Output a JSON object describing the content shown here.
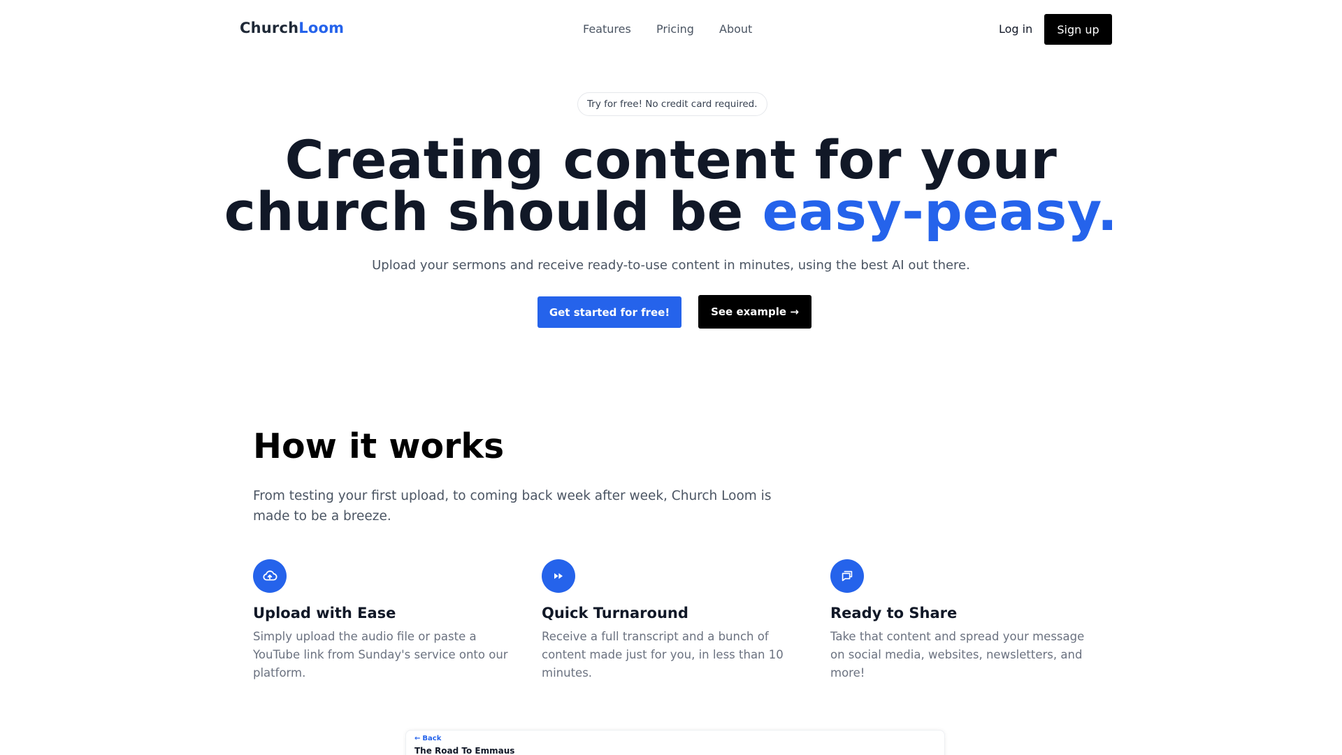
{
  "header": {
    "logo_part1": "Church",
    "logo_part2": "Loom",
    "nav": [
      "Features",
      "Pricing",
      "About"
    ],
    "login_label": "Log in",
    "signup_label": "Sign up"
  },
  "hero": {
    "pill": "Try for free! No credit card required.",
    "title_line1": "Creating content for your",
    "title_line2_plain": "church should be ",
    "title_line2_accent": "easy-peasy.",
    "subtitle": "Upload your sermons and receive ready-to-use content in minutes, using the best AI out there.",
    "primary_button": "Get started for free!",
    "secondary_button": "See example →"
  },
  "how": {
    "title": "How it works",
    "subtitle": "From testing your first upload, to coming back week after week, Church Loom is made to be a breeze.",
    "features": [
      {
        "icon": "cloud-upload-icon",
        "title": "Upload with Ease",
        "desc": "Simply upload the audio file or paste a YouTube link from Sunday's service onto our platform."
      },
      {
        "icon": "fast-forward-icon",
        "title": "Quick Turnaround",
        "desc": "Receive a full transcript and a bunch of content made just for you, in less than 10 minutes."
      },
      {
        "icon": "chat-bubbles-icon",
        "title": "Ready to Share",
        "desc": "Take that content and spread your message on social media, websites, newsletters, and more!"
      }
    ]
  },
  "preview": {
    "back_label": "Back",
    "title": "The Road To Emmaus"
  },
  "colors": {
    "accent": "#2563eb",
    "dark": "#000000",
    "heading": "#111827",
    "muted": "#6b7280"
  }
}
